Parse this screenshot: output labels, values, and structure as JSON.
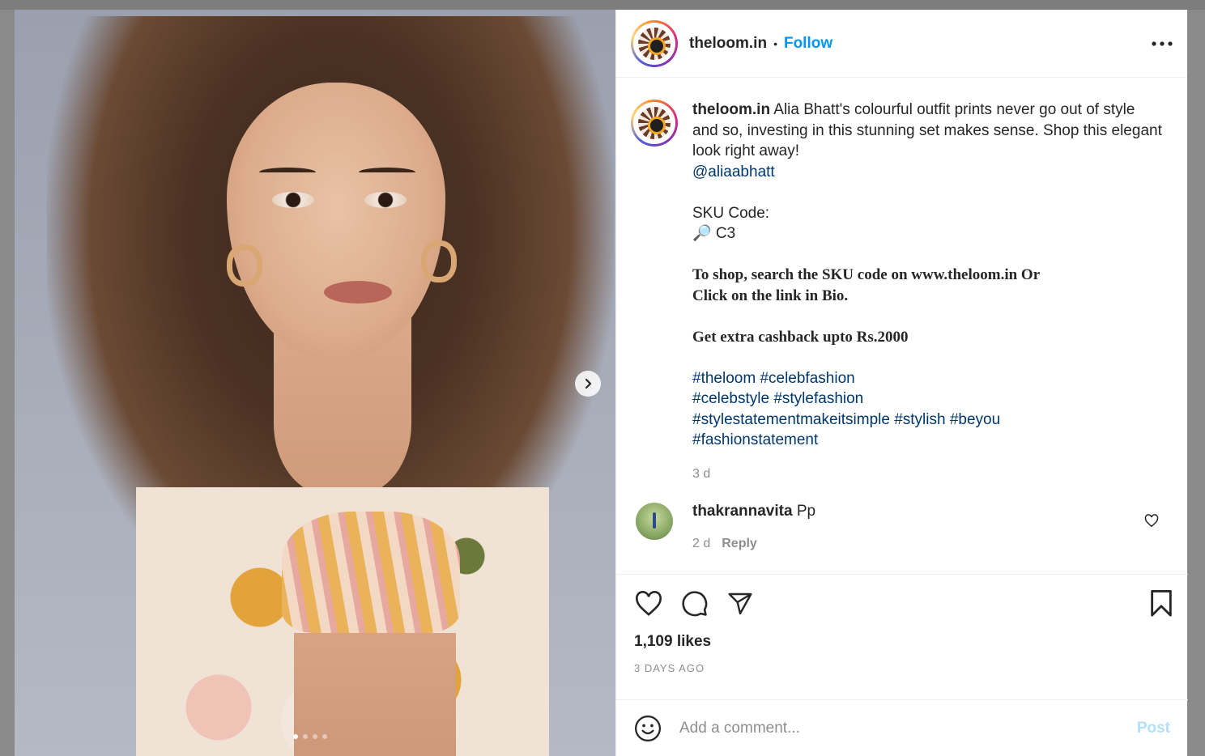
{
  "post": {
    "username": "theloom.in",
    "separator": "•",
    "follow_label": "Follow",
    "more_label": "•••",
    "caption": {
      "username": "theloom.in",
      "text": " Alia Bhatt's colourful outfit prints never go out of style and so, investing in this stunning set makes sense. Shop this elegant look right away!",
      "mention": "@aliaabhatt",
      "sku_label": "SKU Code:",
      "sku_value": "🔎 C3",
      "shop_line_1": "To shop, search the SKU code on www.theloom.in Or",
      "shop_line_2": "Click on the link in Bio.",
      "cashback": "Get extra cashback upto Rs.2000",
      "hashtags_1": "#theloom #celebfashion",
      "hashtags_2": "#celebstyle #stylefashion",
      "hashtags_3": "#stylestatementmakeitsimple #stylish #beyou",
      "hashtags_4": "#fashionstatement",
      "time": "3 d"
    },
    "comment": {
      "username": "thakrannavita",
      "text": " Pp",
      "time": "2 d",
      "reply_label": "Reply"
    },
    "likes": "1,109 likes",
    "posted_ago": "3 DAYS AGO",
    "comment_placeholder": "Add a comment...",
    "post_button": "Post",
    "carousel": {
      "total": 4,
      "active": 1
    }
  },
  "icons": [
    "heart-icon",
    "comment-icon",
    "share-icon",
    "bookmark-icon",
    "emoji-icon",
    "chevron-right-icon",
    "more-icon"
  ],
  "colors": {
    "link": "#00376b",
    "follow": "#0095f6",
    "muted": "#8e8e8e",
    "post_disabled": "#b2dffc"
  }
}
